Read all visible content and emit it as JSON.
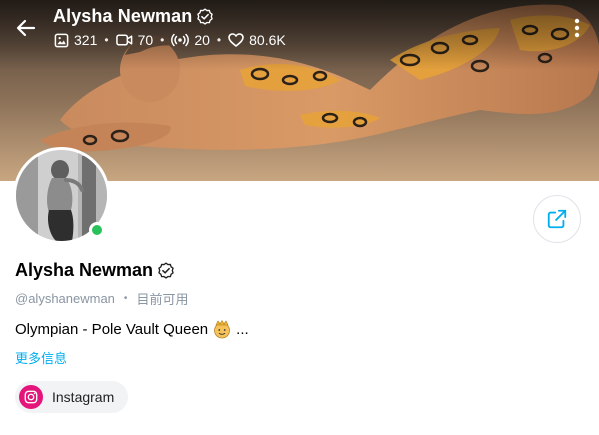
{
  "header": {
    "name": "Alysha Newman",
    "verified": true,
    "stats": {
      "photos": "321",
      "videos": "70",
      "streams": "20",
      "likes": "80.6K"
    },
    "icons": [
      "back-arrow-icon",
      "photo-icon",
      "video-icon",
      "stream-icon",
      "heart-icon",
      "more-vertical-icon"
    ]
  },
  "profile": {
    "name": "Alysha Newman",
    "handle": "@alyshanewman",
    "status": "目前可用",
    "online": true,
    "bio": "Olympian - Pole Vault Queen",
    "bio_suffix": "...",
    "more_info": "更多信息",
    "social": [
      {
        "label": "Instagram",
        "icon": "instagram-icon",
        "color": "#e4147a"
      }
    ]
  },
  "colors": {
    "accent": "#00aff0",
    "online": "#29c15a",
    "muted_text": "#8a96a3",
    "instagram": "#e4147a"
  }
}
